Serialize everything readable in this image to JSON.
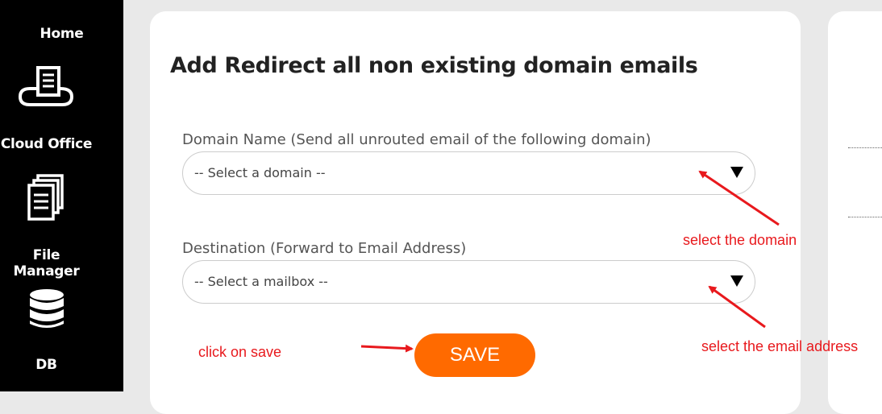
{
  "sidebar": {
    "items": [
      {
        "label": "Home",
        "icon": "home-icon"
      },
      {
        "label": "Cloud Office",
        "icon": "cloud-office-icon"
      },
      {
        "label": "File Manager",
        "icon": "file-manager-icon"
      },
      {
        "label": "DB",
        "icon": "database-icon"
      }
    ]
  },
  "form": {
    "title": "Add Redirect all non existing domain emails",
    "domain": {
      "label": "Domain Name (Send all unrouted email of the following domain)",
      "value": "-- Select a domain --"
    },
    "destination": {
      "label": "Destination (Forward to Email Address)",
      "value": "-- Select a mailbox --"
    },
    "save_label": "SAVE"
  },
  "annotations": {
    "domain": "select the domain",
    "email": "select the email address",
    "save": "click on save"
  },
  "colors": {
    "accent": "#ff6a00",
    "annotation": "#e8191d",
    "sidebar": "#000000"
  }
}
